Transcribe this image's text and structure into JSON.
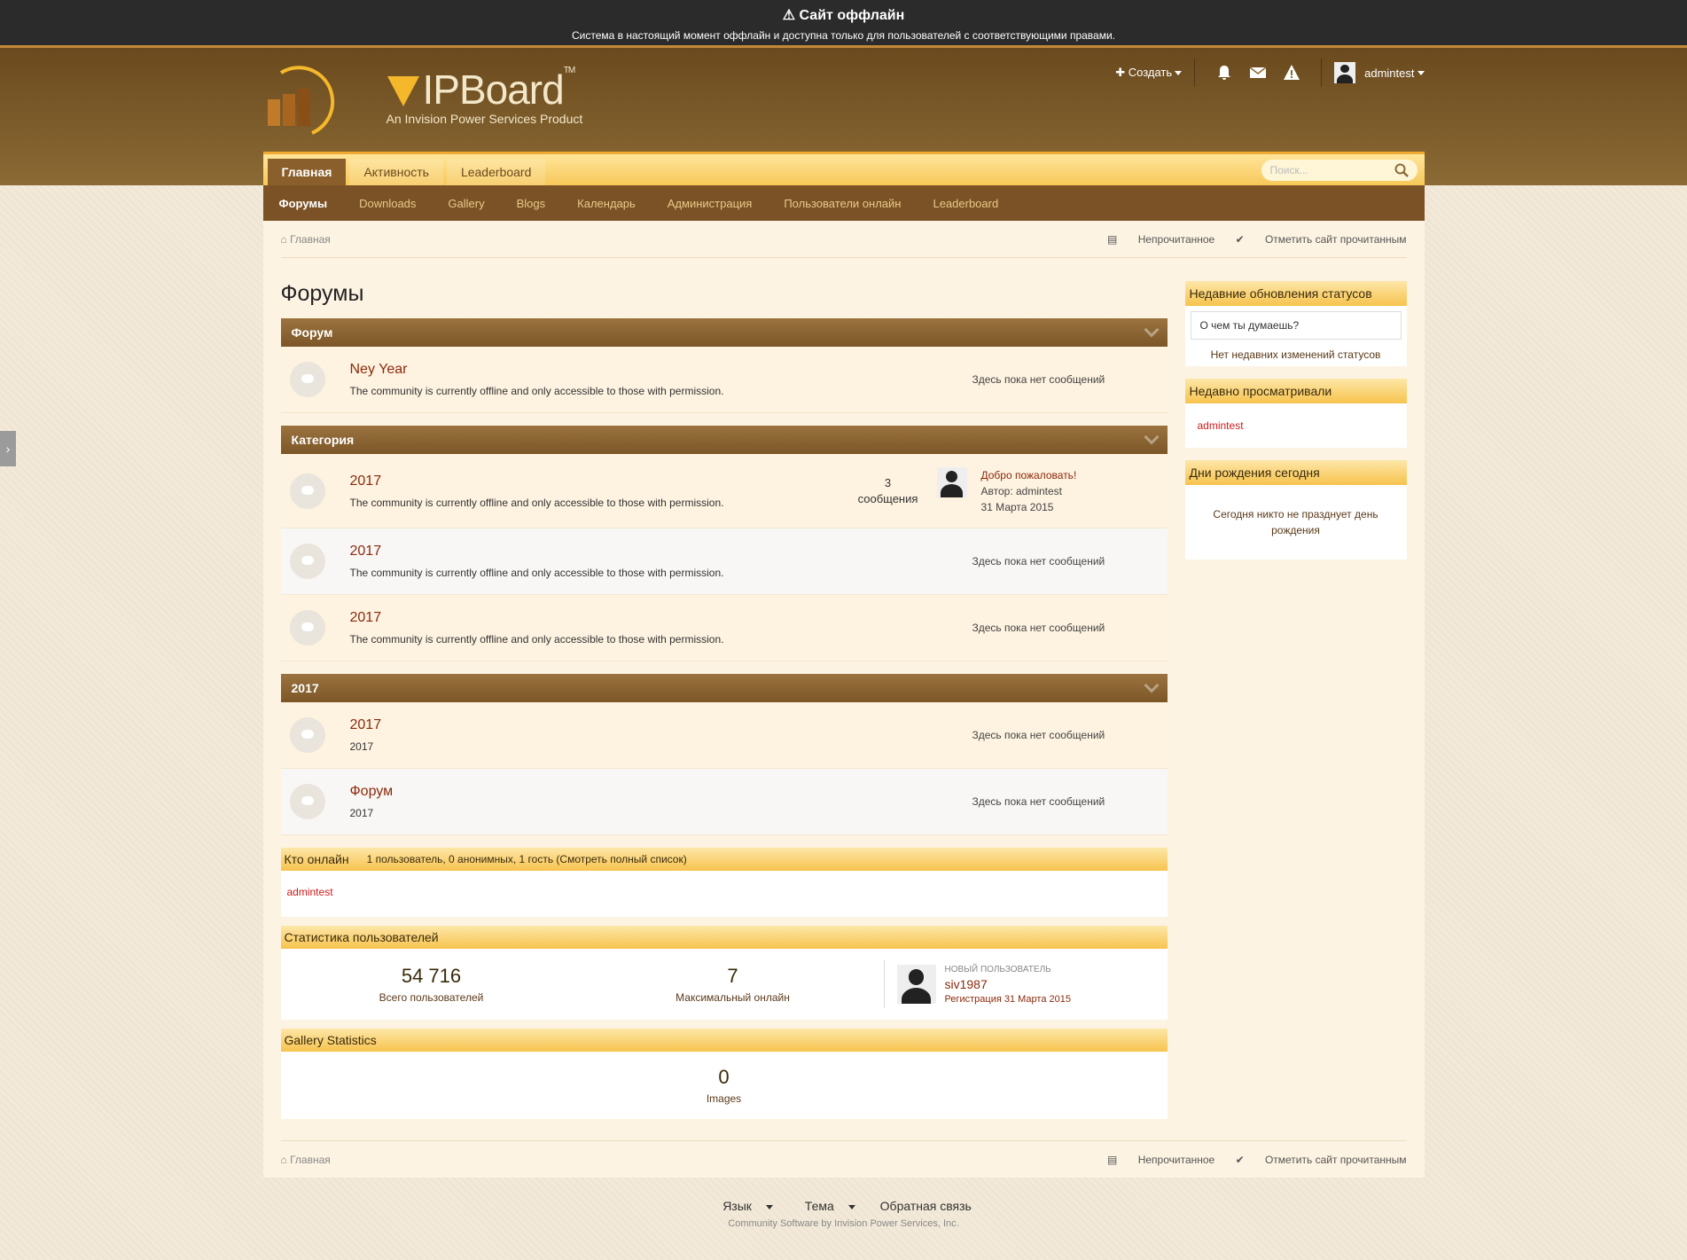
{
  "offline": {
    "title": "Сайт оффлайн",
    "message": "Система в настоящий момент оффлайн и доступна только для пользователей с соответствующими правами."
  },
  "logo": {
    "brand": "IPBoard",
    "tm": "TM",
    "subtitle": "An Invision Power Services Product"
  },
  "userbar": {
    "create": "Создать",
    "username": "admintest"
  },
  "nav_primary": [
    "Главная",
    "Активность",
    "Leaderboard"
  ],
  "search": {
    "placeholder": "Поиск..."
  },
  "nav_secondary": [
    "Форумы",
    "Downloads",
    "Gallery",
    "Blogs",
    "Календарь",
    "Администрация",
    "Пользователи онлайн",
    "Leaderboard"
  ],
  "breadcrumb": {
    "home": "Главная",
    "unread": "Непрочитанное",
    "mark_read": "Отметить сайт прочитанным"
  },
  "page_title": "Форумы",
  "sections": [
    {
      "title": "Форум",
      "forums": [
        {
          "title": "Ney Year",
          "desc": "The community is currently offline and only accessible to those with permission.",
          "last": "Здесь пока нет сообщений"
        }
      ]
    },
    {
      "title": "Категория",
      "forums": [
        {
          "title": "2017",
          "desc": "The community is currently offline and only accessible to those with permission.",
          "count": "3",
          "count_label": "сообщения",
          "last_title": "Добро пожаловать!",
          "last_author": "Автор: admintest",
          "last_date": "31 Марта 2015"
        },
        {
          "title": "2017",
          "desc": "The community is currently offline and only accessible to those with permission.",
          "last": "Здесь пока нет сообщений"
        },
        {
          "title": "2017",
          "desc": "The community is currently offline and only accessible to those with permission.",
          "last": "Здесь пока нет сообщений"
        }
      ]
    },
    {
      "title": "2017",
      "forums": [
        {
          "title": "2017",
          "desc": "2017",
          "last": "Здесь пока нет сообщений"
        },
        {
          "title": "Форум",
          "desc": "2017",
          "last": "Здесь пока нет сообщений"
        }
      ]
    }
  ],
  "online": {
    "title": "Кто онлайн",
    "summary": "1 пользователь, 0 анонимных, 1 гость (Смотреть полный список)",
    "user": "admintest"
  },
  "user_stats": {
    "title": "Статистика пользователей",
    "total": "54 716",
    "total_label": "Всего пользователей",
    "max": "7",
    "max_label": "Максимальный онлайн",
    "new_label": "НОВЫЙ ПОЛЬЗОВАТЕЛЬ",
    "new_name": "siv1987",
    "new_date": "Регистрация 31 Марта 2015"
  },
  "gallery_stats": {
    "title": "Gallery Statistics",
    "count": "0",
    "label": "Images"
  },
  "sidebar": {
    "status": {
      "title": "Недавние обновления статусов",
      "input": "О чем ты думаешь?",
      "empty": "Нет недавних изменений статусов"
    },
    "recent": {
      "title": "Недавно просматривали",
      "user": "admintest"
    },
    "birthdays": {
      "title": "Дни рождения сегодня",
      "empty": "Сегодня никто не празднует день рождения"
    }
  },
  "footer": {
    "language": "Язык",
    "theme": "Тема",
    "feedback": "Обратная связь",
    "copyright": "Community Software by Invision Power Services, Inc."
  },
  "colors": {
    "accent": "#7b5225",
    "link": "#8b2a0c",
    "highlight": "#f7c34e"
  }
}
